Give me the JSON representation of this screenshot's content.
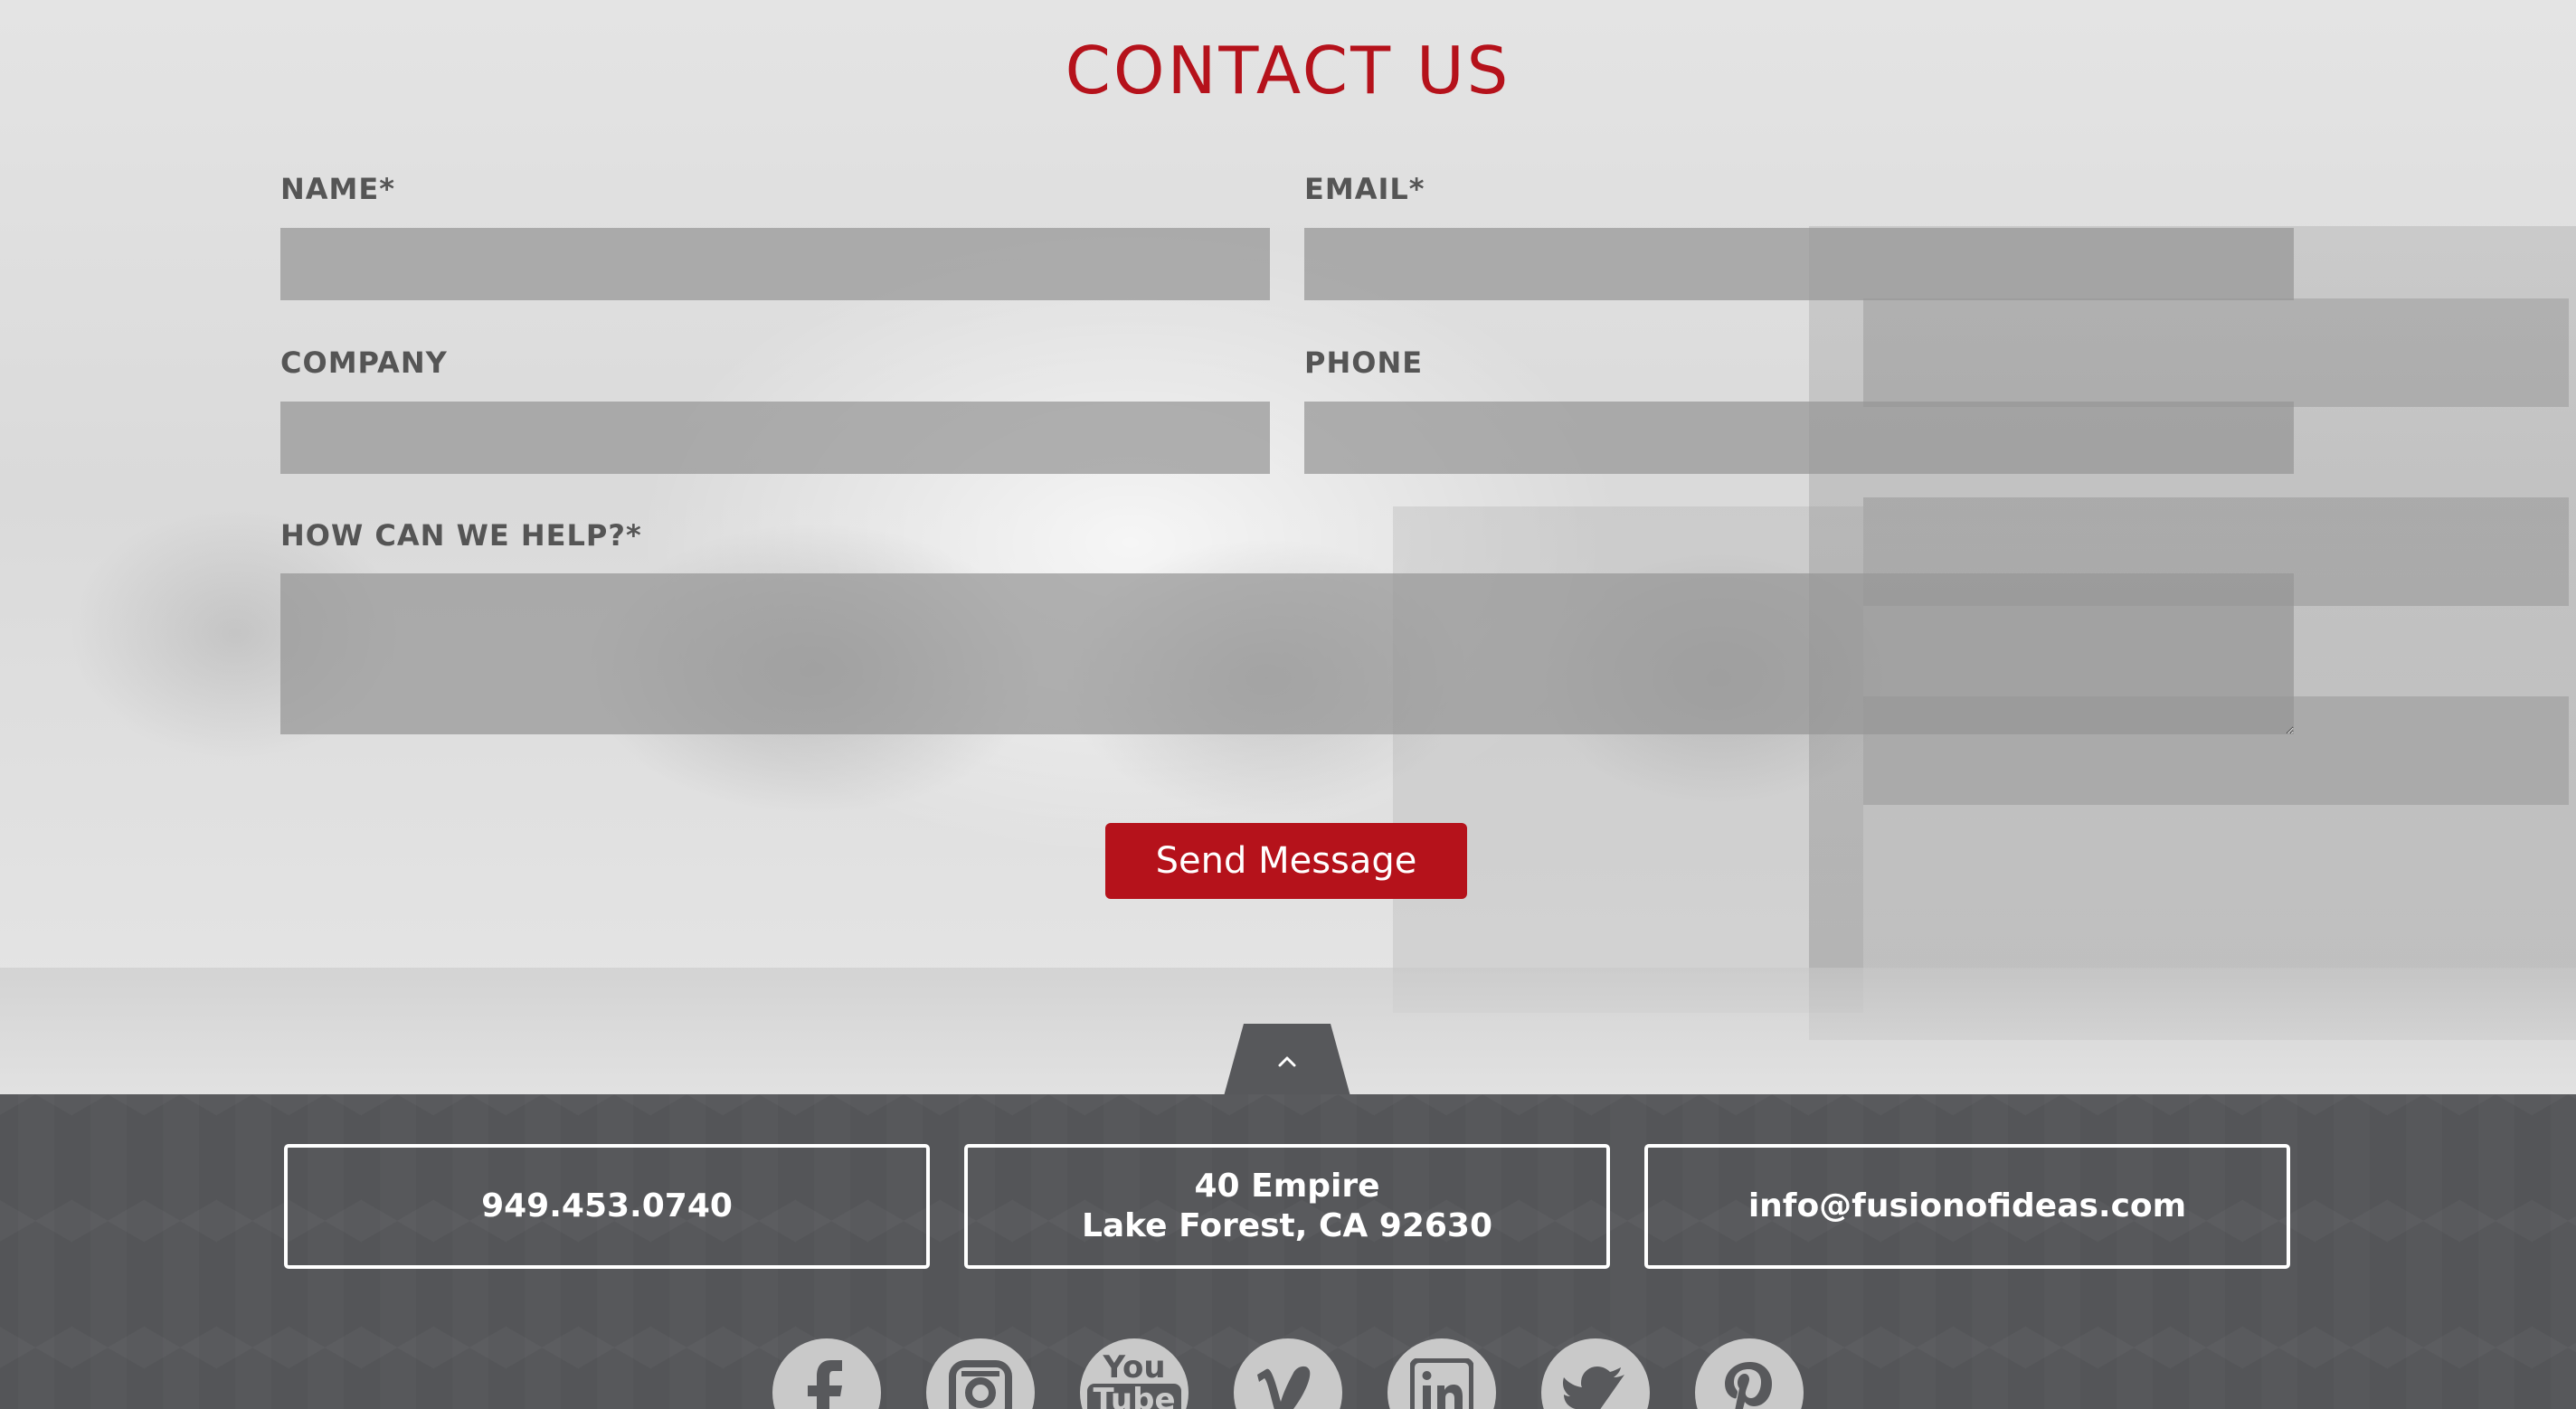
{
  "contact": {
    "title": "CONTACT US",
    "fields": {
      "name": {
        "label": "NAME*",
        "value": "",
        "placeholder": ""
      },
      "email": {
        "label": "EMAIL*",
        "value": "",
        "placeholder": ""
      },
      "company": {
        "label": "COMPANY",
        "value": "",
        "placeholder": ""
      },
      "phone": {
        "label": "PHONE",
        "value": "",
        "placeholder": ""
      },
      "help": {
        "label": "HOW CAN WE HELP?*",
        "value": "",
        "placeholder": ""
      }
    },
    "send_label": "Send Message"
  },
  "footer": {
    "phone": "949.453.0740",
    "address_line1": "40 Empire",
    "address_line2": "Lake Forest, CA 92630",
    "email": "info@fusionofideas.com",
    "social": [
      {
        "icon": "facebook-icon"
      },
      {
        "icon": "instagram-icon"
      },
      {
        "icon": "youtube-icon",
        "text_top": "You",
        "text_bottom": "Tube"
      },
      {
        "icon": "vimeo-icon"
      },
      {
        "icon": "linkedin-icon"
      },
      {
        "icon": "twitter-icon"
      },
      {
        "icon": "pinterest-icon"
      }
    ]
  },
  "colors": {
    "accent": "#b5121b",
    "footer_bg": "#57585b",
    "label": "#555555",
    "field_bg": "#969696",
    "social_circle": "#c9c9c9"
  }
}
